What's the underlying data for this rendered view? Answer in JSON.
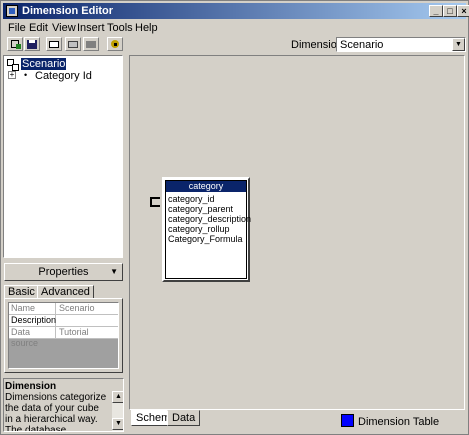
{
  "window": {
    "title": "Dimension Editor"
  },
  "menu": {
    "items": [
      "File",
      "Edit",
      "View",
      "Insert",
      "Tools",
      "Help"
    ]
  },
  "toolbar": {
    "dimension_label": "Dimension:",
    "dimension_value": "Scenario"
  },
  "tree": {
    "root_label": "Scenario",
    "child_label": "Category Id"
  },
  "properties": {
    "header": "Properties",
    "tabs": [
      "Basic",
      "Advanced"
    ],
    "rows": [
      {
        "name": "Name",
        "value": "Scenario"
      },
      {
        "name": "Description",
        "value": ""
      },
      {
        "name": "Data source",
        "value": "Tutorial"
      }
    ]
  },
  "description": {
    "title": "Dimension",
    "body": "Dimensions categorize the data of your cube in a hierarchical way. The database dimension can be"
  },
  "schema": {
    "table_name": "category",
    "fields": [
      "category_id",
      "category_parent",
      "category_description",
      "category_rollup",
      "Category_Formula"
    ]
  },
  "bottom": {
    "tabs": [
      "Schema",
      "Data"
    ],
    "legend_label": "Dimension Table",
    "legend_color": "#0000ff"
  },
  "icons": [
    "app-icon",
    "dimension-wizard-icon",
    "save-icon",
    "schema-icon",
    "data-icon",
    "grid-icon",
    "process-icon"
  ]
}
